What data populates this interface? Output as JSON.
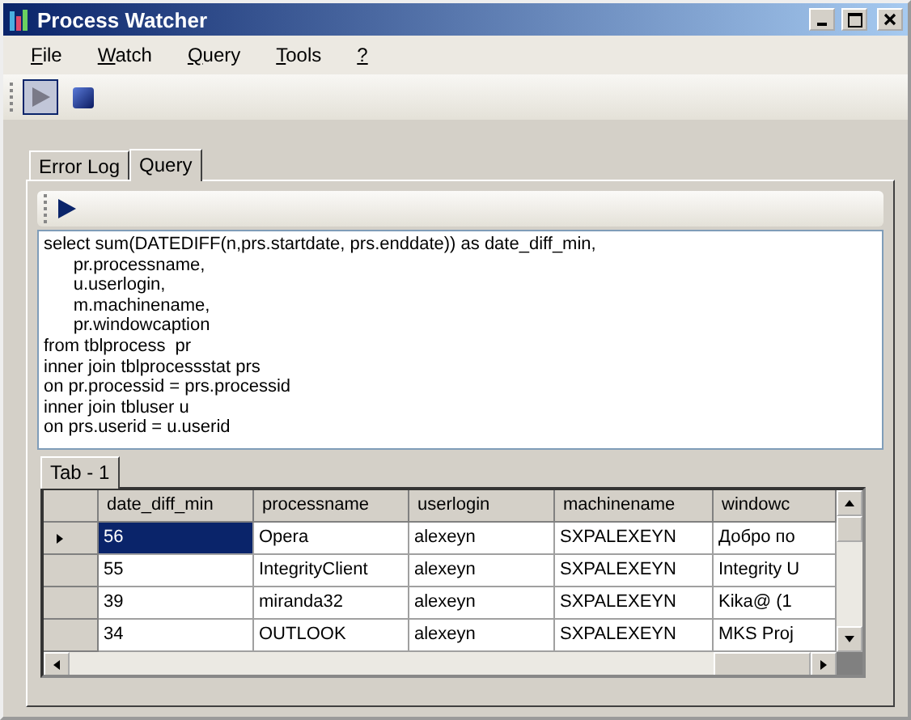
{
  "window": {
    "title": "Process Watcher"
  },
  "menu": [
    {
      "label": "File"
    },
    {
      "label": "Watch"
    },
    {
      "label": "Query"
    },
    {
      "label": "Tools"
    },
    {
      "label": "?"
    }
  ],
  "toolbar": [
    {
      "kind": "play",
      "pressed": true
    },
    {
      "kind": "stop",
      "pressed": false
    }
  ],
  "tabs": [
    {
      "label": "Error Log",
      "selected": false
    },
    {
      "label": "Query",
      "selected": true
    }
  ],
  "query": {
    "lines": [
      "select sum(DATEDIFF(n,prs.startdate, prs.enddate)) as date_diff_min,",
      "      pr.processname,",
      "      u.userlogin,",
      "      m.machinename,",
      "      pr.windowcaption",
      "from tblprocess  pr",
      "inner join tblprocessstat prs",
      "on pr.processid = prs.processid",
      "inner join tbluser u",
      "on prs.userid = u.userid"
    ]
  },
  "result_tabs": [
    {
      "label": "Tab - 1",
      "selected": true
    }
  ],
  "table": {
    "columns": [
      "date_diff_min",
      "processname",
      "userlogin",
      "machinename",
      "windowc"
    ],
    "rows": [
      {
        "selected": true,
        "cells": [
          "56",
          "Opera",
          "alexeyn",
          "SXPALEXEYN",
          "Добро по"
        ]
      },
      {
        "selected": false,
        "cells": [
          "55",
          "IntegrityClient",
          "alexeyn",
          "SXPALEXEYN",
          "Integrity U"
        ]
      },
      {
        "selected": false,
        "cells": [
          "39",
          "miranda32",
          "alexeyn",
          "SXPALEXEYN",
          "Kika@ (1"
        ]
      },
      {
        "selected": false,
        "cells": [
          "34",
          "OUTLOOK",
          "alexeyn",
          "SXPALEXEYN",
          "MKS Proj"
        ]
      }
    ]
  }
}
